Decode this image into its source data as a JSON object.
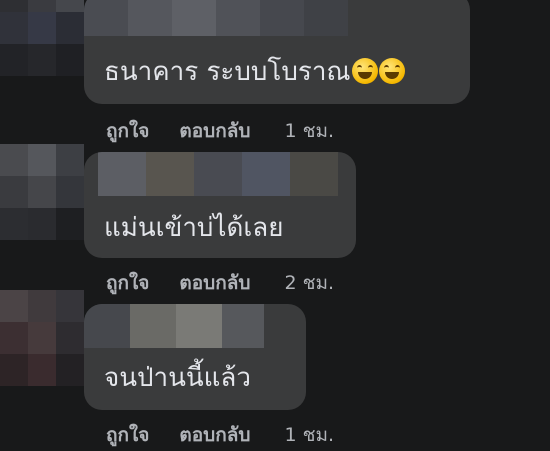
{
  "comments": [
    {
      "text": "ธนาคาร ระบบโบราณ",
      "emoji": [
        "grinning-squinting-face",
        "grinning-squinting-face"
      ],
      "like_label": "ถูกใจ",
      "reply_label": "ตอบกลับ",
      "time": "1 ชม."
    },
    {
      "text": "แม่นเข้าบ่ได้เลย",
      "like_label": "ถูกใจ",
      "reply_label": "ตอบกลับ",
      "time": "2 ชม."
    },
    {
      "text": "จนป่านนี้แล้ว",
      "like_label": "ถูกใจ",
      "reply_label": "ตอบกลับ",
      "time": "1 ชม."
    }
  ],
  "colors": {
    "background": "#18191a",
    "bubble": "#3a3b3c",
    "text": "#e4e6eb",
    "secondary_text": "#b0b3b8"
  }
}
